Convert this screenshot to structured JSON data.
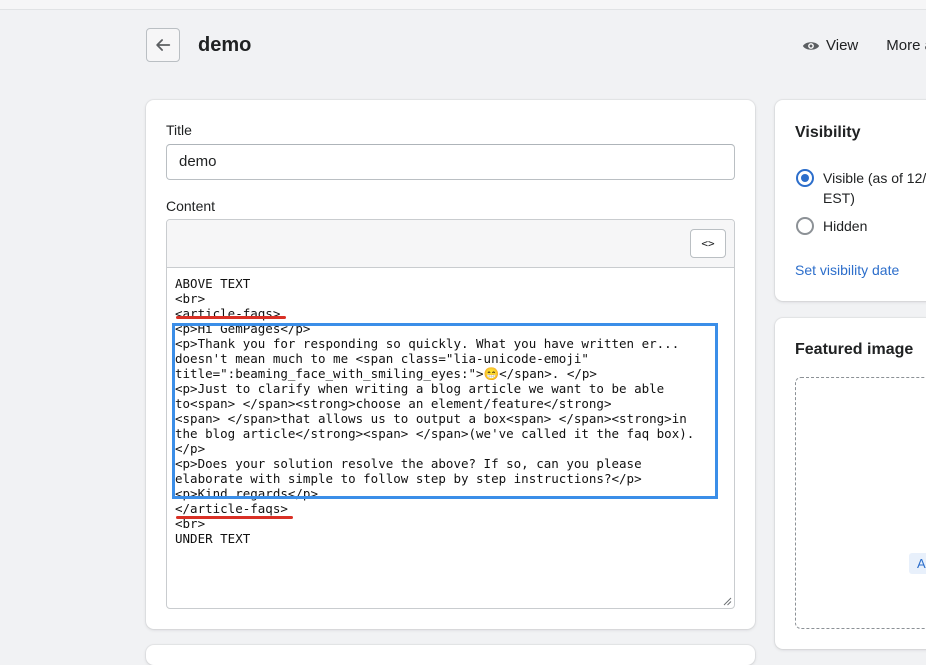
{
  "header": {
    "title": "demo",
    "view_label": "View",
    "more_label": "More a"
  },
  "main": {
    "title_label": "Title",
    "title_value": "demo",
    "content_label": "Content",
    "code_toggle_label": "<>",
    "code_lines": [
      "ABOVE TEXT",
      "<br>",
      "<article-faqs>",
      "<p>Hi GemPages</p>",
      "<p>Thank you for responding so quickly. What you have written er...",
      "doesn't mean much to me <span class=\"lia-unicode-emoji\"",
      "title=\":beaming_face_with_smiling_eyes:\">😁</span>. </p>",
      "<p>Just to clarify when writing a blog article we want to be able",
      "to<span> </span><strong>choose an element/feature</strong>",
      "<span> </span>that allows us to output a box<span> </span><strong>in",
      "the blog article</strong><span> </span>(we've called it the faq box).",
      "</p>",
      "<p>Does your solution resolve the above? If so, can you please",
      "elaborate with simple to follow step by step instructions?</p>",
      "<p>Kind regards</p>",
      "</article-faqs>",
      "<br>",
      "UNDER TEXT"
    ]
  },
  "visibility": {
    "title": "Visibility",
    "visible_label_line1": "Visible (as of 12/",
    "visible_label_line2": "EST)",
    "hidden_label": "Hidden",
    "set_date_link": "Set visibility date",
    "selected": "visible"
  },
  "featured": {
    "title": "Featured image",
    "add_label": "Add i"
  },
  "colors": {
    "accent": "#2c6ecb",
    "annotation_box": "#3b8ee8",
    "annotation_underline": "#d93025"
  }
}
